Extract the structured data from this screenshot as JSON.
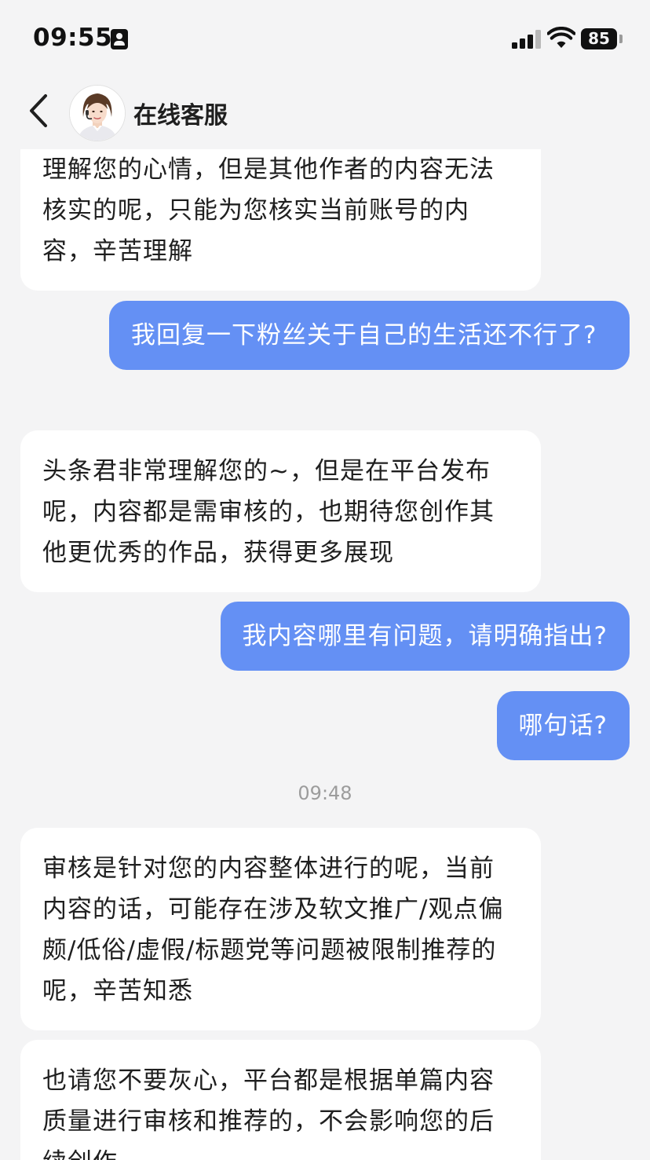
{
  "status_bar": {
    "time": "09:55",
    "battery": "85",
    "contact_icon": "person-card-icon",
    "signal_icon": "cellular-signal-icon",
    "wifi_icon": "wifi-icon"
  },
  "header": {
    "title": "在线客服",
    "back_icon": "chevron-left-icon",
    "avatar_icon": "customer-service-avatar"
  },
  "colors": {
    "user_bubble": "#6490f4",
    "agent_bubble": "#ffffff",
    "background": "#f4f4f5"
  },
  "messages": [
    {
      "sender": "agent",
      "text": "理解您的心情，但是其他作者的内容无法核实的呢，只能为您核实当前账号的内容，辛苦理解"
    },
    {
      "sender": "user",
      "text": "我回复一下粉丝关于自己的生活还不行了?"
    },
    {
      "sender": "agent",
      "text": "头条君非常理解您的~，但是在平台发布呢，内容都是需审核的，也期待您创作其他更优秀的作品，获得更多展现"
    },
    {
      "sender": "user",
      "text": "我内容哪里有问题，请明确指出?"
    },
    {
      "sender": "user",
      "text": "哪句话?"
    },
    {
      "sender": "system",
      "text": "09:48"
    },
    {
      "sender": "agent",
      "text": "审核是针对您的内容整体进行的呢，当前内容的话，可能存在涉及软文推广/观点偏颇/低俗/虚假/标题党等问题被限制推荐的呢，辛苦知悉"
    },
    {
      "sender": "agent",
      "text": "也请您不要灰心，平台都是根据单篇内容质量进行审核和推荐的，不会影响您的后续创作"
    }
  ]
}
